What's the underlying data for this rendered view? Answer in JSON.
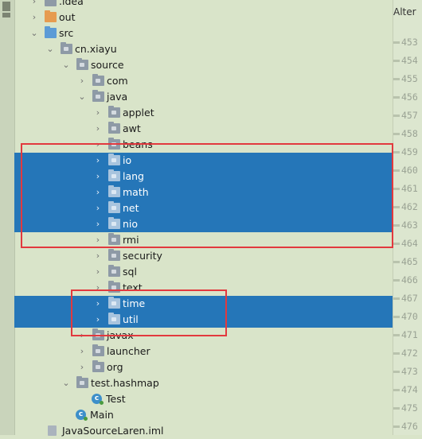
{
  "tree": {
    "rows": [
      {
        "label": ".idea",
        "chev": "›",
        "icon": "folder",
        "sel": false
      },
      {
        "label": "out",
        "chev": "›",
        "icon": "folder-orange",
        "sel": false
      },
      {
        "label": "src",
        "chev": "⌄",
        "icon": "folder-blue",
        "sel": false
      },
      {
        "label": "cn.xiayu",
        "chev": "⌄",
        "icon": "folder-pkg",
        "sel": false
      },
      {
        "label": "source",
        "chev": "⌄",
        "icon": "folder-pkg",
        "sel": false
      },
      {
        "label": "com",
        "chev": "›",
        "icon": "folder-pkg",
        "sel": false
      },
      {
        "label": "java",
        "chev": "⌄",
        "icon": "folder-pkg",
        "sel": false
      },
      {
        "label": "applet",
        "chev": "›",
        "icon": "folder-pkg",
        "sel": false
      },
      {
        "label": "awt",
        "chev": "›",
        "icon": "folder-pkg",
        "sel": false
      },
      {
        "label": "beans",
        "chev": "›",
        "icon": "folder-pkg",
        "sel": false
      },
      {
        "label": "io",
        "chev": "›",
        "icon": "folder-pkg",
        "sel": true
      },
      {
        "label": "lang",
        "chev": "›",
        "icon": "folder-pkg",
        "sel": true
      },
      {
        "label": "math",
        "chev": "›",
        "icon": "folder-pkg",
        "sel": true
      },
      {
        "label": "net",
        "chev": "›",
        "icon": "folder-pkg",
        "sel": true
      },
      {
        "label": "nio",
        "chev": "›",
        "icon": "folder-pkg",
        "sel": true
      },
      {
        "label": "rmi",
        "chev": "›",
        "icon": "folder-pkg",
        "sel": false
      },
      {
        "label": "security",
        "chev": "›",
        "icon": "folder-pkg",
        "sel": false
      },
      {
        "label": "sql",
        "chev": "›",
        "icon": "folder-pkg",
        "sel": false
      },
      {
        "label": "text",
        "chev": "›",
        "icon": "folder-pkg",
        "sel": false
      },
      {
        "label": "time",
        "chev": "›",
        "icon": "folder-pkg",
        "sel": true
      },
      {
        "label": "util",
        "chev": "›",
        "icon": "folder-pkg",
        "sel": true
      },
      {
        "label": "javax",
        "chev": "›",
        "icon": "folder-pkg",
        "sel": false
      },
      {
        "label": "launcher",
        "chev": "›",
        "icon": "folder-pkg",
        "sel": false
      },
      {
        "label": "org",
        "chev": "›",
        "icon": "folder-pkg",
        "sel": false
      },
      {
        "label": "test.hashmap",
        "chev": "⌄",
        "icon": "folder-pkg",
        "sel": false
      },
      {
        "label": "Test",
        "chev": "",
        "icon": "class",
        "sel": false
      },
      {
        "label": "Main",
        "chev": "",
        "icon": "class",
        "sel": false
      },
      {
        "label": "JavaSourceLaren.iml",
        "chev": "",
        "icon": "file",
        "sel": false
      }
    ]
  },
  "gutter": {
    "header": "Alter",
    "line_numbers": [
      "453",
      "454",
      "455",
      "456",
      "457",
      "458",
      "459",
      "460",
      "461",
      "462",
      "463",
      "464",
      "465",
      "466",
      "467",
      "470",
      "471",
      "472",
      "473",
      "474",
      "475",
      "476"
    ]
  },
  "colors": {
    "selection": "#2576b8",
    "highlight": "#e2393e",
    "background": "#d9e4c9"
  }
}
